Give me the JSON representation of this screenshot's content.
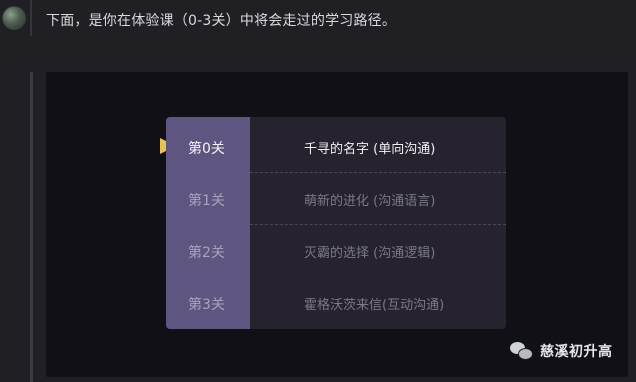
{
  "message": {
    "intro": "下面，是你在体验课（0-3关）中将会走过的学习路径。"
  },
  "levels": [
    {
      "label": "第0关",
      "title": "千寻的名字 (单向沟通)",
      "active": true
    },
    {
      "label": "第1关",
      "title": "萌新的进化 (沟通语言)",
      "active": false
    },
    {
      "label": "第2关",
      "title": "灭霸的选择 (沟通逻辑)",
      "active": false
    },
    {
      "label": "第3关",
      "title": "霍格沃茨来信(互动沟通)",
      "active": false
    }
  ],
  "icons": {
    "avatar": "avatar-icon",
    "pointer": "play-pointer-icon",
    "watermark": "wechat-icon"
  },
  "colors": {
    "background": "#1f1f24",
    "stage": "#121017",
    "panel": "#26232e",
    "level_column": "#5e5680",
    "pointer": "#e8c255"
  },
  "watermark": {
    "text": "慈溪初升高"
  }
}
